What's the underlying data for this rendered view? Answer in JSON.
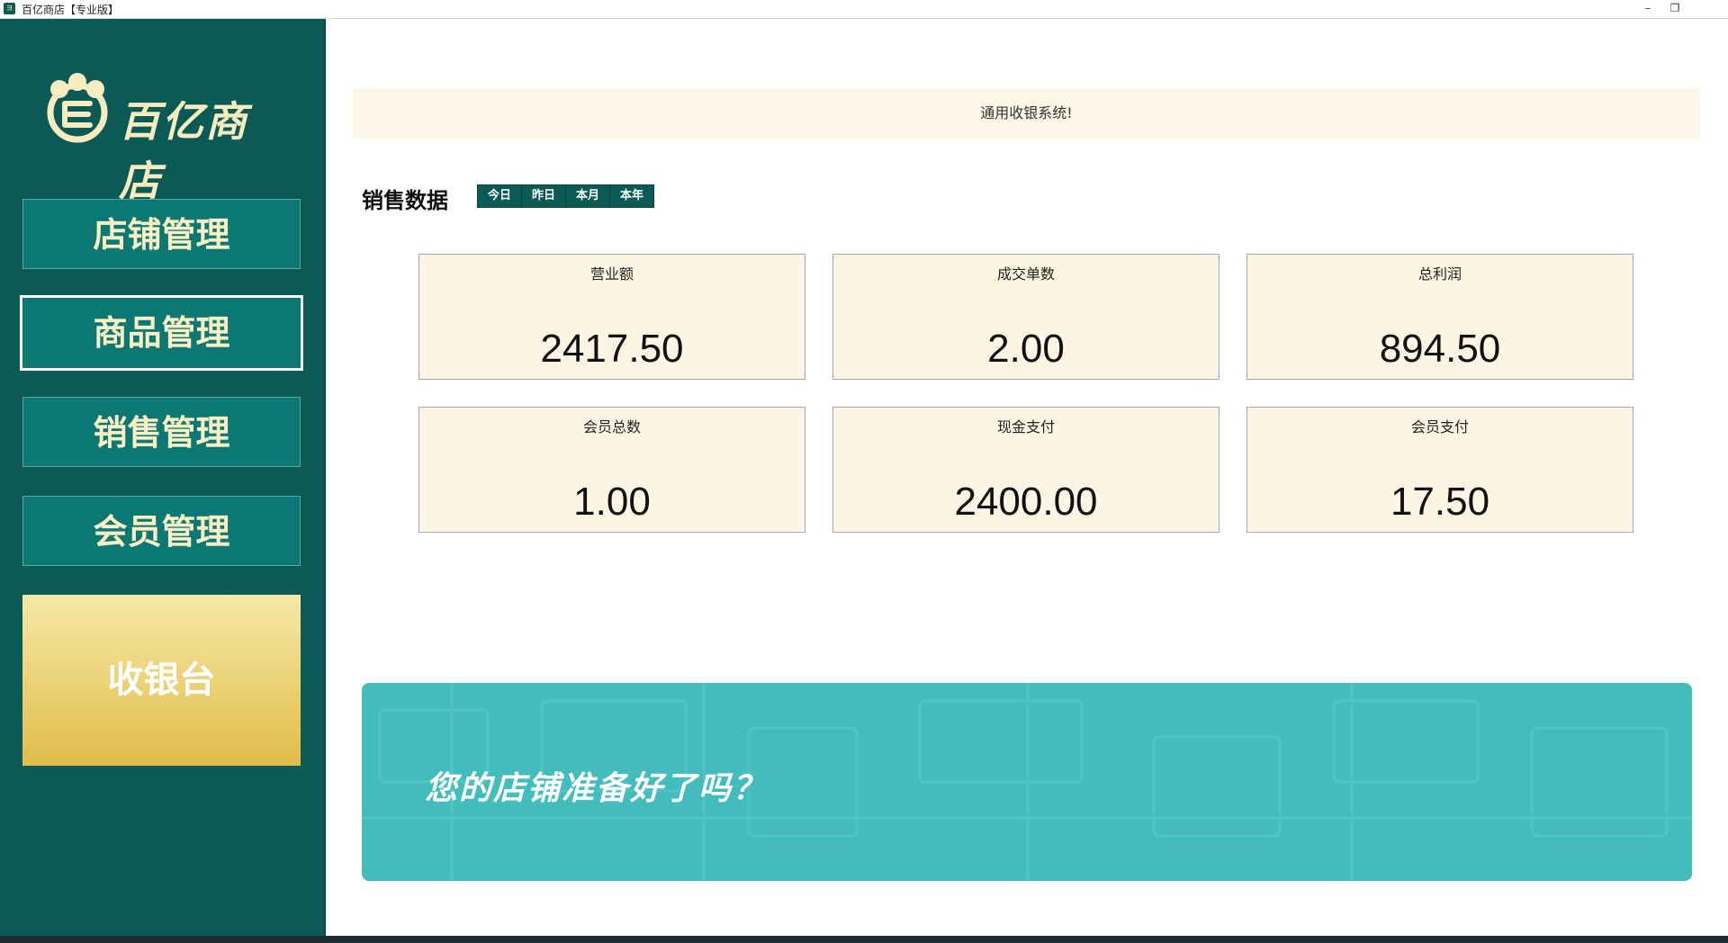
{
  "window": {
    "title": "百亿商店【专业版】",
    "minimize_glyph": "–",
    "restore_glyph": "❐"
  },
  "sidebar": {
    "logo_text": "百亿商店",
    "nav": [
      {
        "label": "店铺管理"
      },
      {
        "label": "商品管理"
      },
      {
        "label": "销售管理"
      },
      {
        "label": "会员管理"
      }
    ],
    "cashier_label": "收银台"
  },
  "main": {
    "notice": "通用收银系统!",
    "sales_title": "销售数据",
    "period_tabs": [
      "今日",
      "昨日",
      "本月",
      "本年"
    ],
    "stats": [
      {
        "label": "营业额",
        "value": "2417.50"
      },
      {
        "label": "成交单数",
        "value": "2.00"
      },
      {
        "label": "总利润",
        "value": "894.50"
      },
      {
        "label": "会员总数",
        "value": "1.00"
      },
      {
        "label": "现金支付",
        "value": "2400.00"
      },
      {
        "label": "会员支付",
        "value": "17.50"
      }
    ],
    "banner_text": "您的店铺准备好了吗？"
  },
  "colors": {
    "sidebar_bg": "#0b5a55",
    "nav_button": "#0c7873",
    "nav_text": "#fbf0c4",
    "cashier_gradient_top": "#f6e8a6",
    "cashier_gradient_bottom": "#e0bd4a",
    "card_bg": "#fdf5e3",
    "banner_bg": "#43bcbd"
  }
}
